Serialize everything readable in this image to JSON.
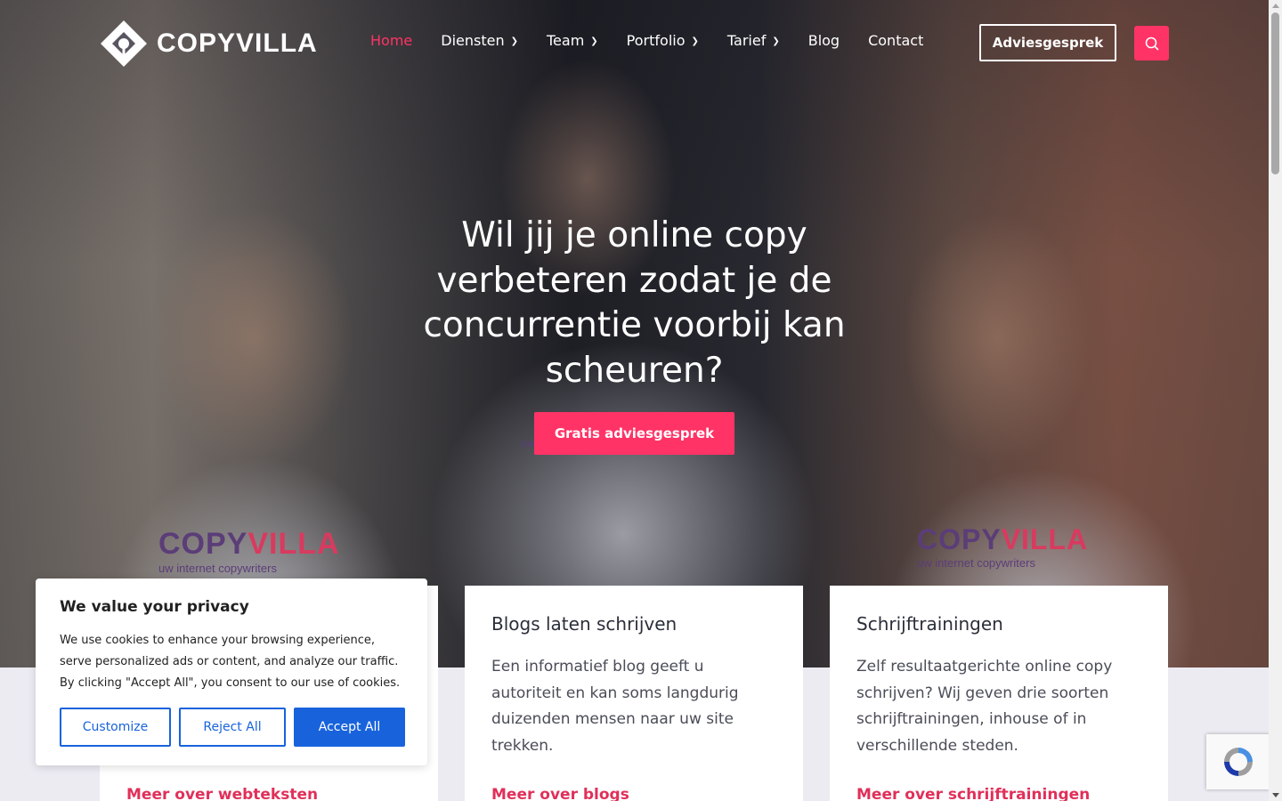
{
  "header": {
    "logo_text": "COPYVILLA",
    "nav": [
      {
        "label": "Home",
        "active": true,
        "has_dropdown": false
      },
      {
        "label": "Diensten",
        "active": false,
        "has_dropdown": true
      },
      {
        "label": "Team",
        "active": false,
        "has_dropdown": true
      },
      {
        "label": "Portfolio",
        "active": false,
        "has_dropdown": true
      },
      {
        "label": "Tarief",
        "active": false,
        "has_dropdown": true
      },
      {
        "label": "Blog",
        "active": false,
        "has_dropdown": false
      },
      {
        "label": "Contact",
        "active": false,
        "has_dropdown": false
      }
    ],
    "cta_label": "Adviesgesprek",
    "search_icon": "search-icon"
  },
  "hero": {
    "title": "Wil jij je online copy verbeteren zodat je de concurrentie voorbij kan scheuren?",
    "cta_label": "Gratis adviesgesprek",
    "shirt_brand": {
      "part1": "COPY",
      "part2": "VILLA",
      "tagline": "uw internet copywriters"
    }
  },
  "cards": [
    {
      "title": "",
      "text": "",
      "link": "Meer over webteksten"
    },
    {
      "title": "Blogs laten schrijven",
      "text": "Een informatief blog geeft u autoriteit en kan soms langdurig duizenden mensen naar uw site trekken.",
      "link": "Meer over blogs"
    },
    {
      "title": "Schrijftrainingen",
      "text": "Zelf resultaatgerichte online copy schrijven? Wij geven drie soorten schrijftrainingen, inhouse of in verschillende steden.",
      "link": "Meer over schrijftrainingen"
    }
  ],
  "cookie": {
    "title": "We value your privacy",
    "text": "We use cookies to enhance your browsing experience, serve personalized ads or content, and analyze our traffic. By clicking \"Accept All\", you consent to our use of cookies.",
    "customize_label": "Customize",
    "reject_label": "Reject All",
    "accept_label": "Accept All"
  },
  "colors": {
    "accent": "#ff3366",
    "link": "#e0305a",
    "cookie_blue": "#1863dc",
    "page_bg": "#ecebf2"
  }
}
